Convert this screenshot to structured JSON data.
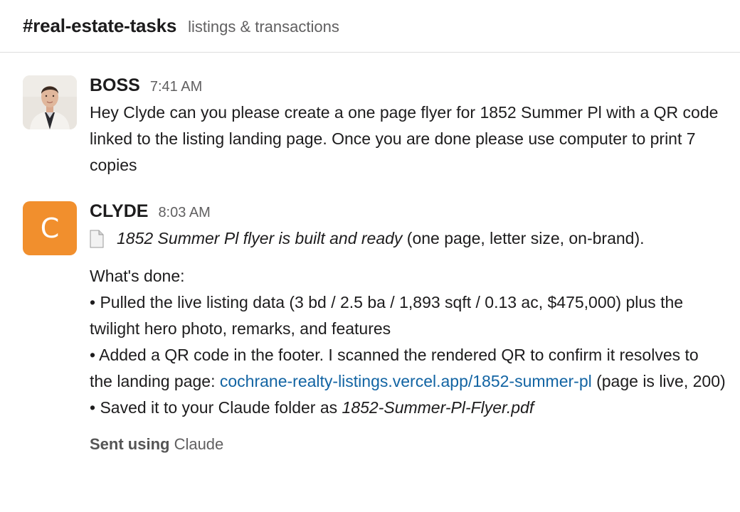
{
  "channel": {
    "name": "#real-estate-tasks",
    "topic": "listings & transactions"
  },
  "colors": {
    "clyde_avatar": "#f18f2d",
    "link": "#1264a3"
  },
  "messages": [
    {
      "sender": "BOSS",
      "time": "7:41 AM",
      "avatar": "photo",
      "text": "Hey Clyde can you please create a one page flyer for 1852 Summer Pl with a QR code linked to the listing landing page. Once you are done please use computer to print 7 copies"
    },
    {
      "sender": "CLYDE",
      "time": "8:03 AM",
      "avatar_letter": "C",
      "file_icon": "document-icon",
      "file_title": "1852 Summer Pl flyer is built and ready",
      "file_suffix": " (one page, letter size, on-brand).",
      "done_heading": "What's done:",
      "bullet1": "• Pulled the live listing data (3 bd / 2.5 ba / 1,893 sqft / 0.13 ac, $475,000) plus the twilight hero photo, remarks, and features",
      "bullet2_prefix": "• Added a QR code in the footer. I scanned the rendered QR to confirm it resolves to the landing page: ",
      "bullet2_link": "cochrane-realty-listings.vercel.app/1852-summer-pl",
      "bullet2_suffix": " (page is live, 200)",
      "bullet3_prefix": "• Saved it to your Claude folder as ",
      "bullet3_file": "1852-Summer-Pl-Flyer.pdf",
      "sent_using_label": "Sent using",
      "sent_using_app": " Claude"
    }
  ]
}
